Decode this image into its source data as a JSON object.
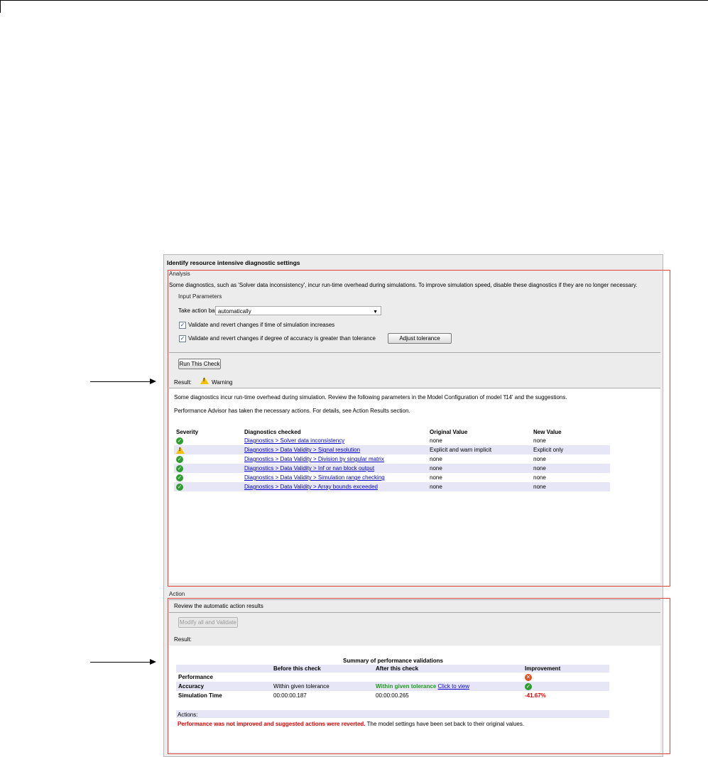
{
  "panel": {
    "title": "Identify resource intensive diagnostic settings",
    "analysis_label": "Analysis",
    "analysis_text": "Some diagnostics, such as 'Solver data inconsistency', incur run-time overhead during simulations. To improve simulation speed, disable these diagnostics if they are no longer necessary.",
    "input_parameters_label": "Input Parameters",
    "take_action_label": "Take action based on advice",
    "take_action_value": "automatically",
    "checkbox_time_label": "Validate and revert changes if time of simulation increases",
    "checkbox_accuracy_label": "Validate and revert changes if degree of accuracy is greater than tolerance",
    "adjust_tolerance_label": "Adjust tolerance",
    "run_check_label": "Run This Check",
    "result_label": "Result:",
    "result_status": "Warning",
    "result_text_1": "Some diagnostics incur run-time overhead during simulation. Review the following parameters in the Model Configuration of model 'f14' and the suggestions.",
    "result_text_2": "Performance Advisor has taken the necessary actions. For details, see Action Results section."
  },
  "diagnostics_table": {
    "headers": [
      "Severity",
      "Diagnostics checked",
      "Original Value",
      "New Value"
    ],
    "rows": [
      {
        "severity": "ok",
        "diagnostic": "Diagnostics > Solver data inconsistency",
        "original": "none",
        "new": "none"
      },
      {
        "severity": "warning",
        "diagnostic": "Diagnostics > Data Validity > Signal resolution",
        "original": "Explicit and warn implicit",
        "new": "Explicit only"
      },
      {
        "severity": "ok",
        "diagnostic": "Diagnostics > Data Validity > Division by singular matrix",
        "original": "none",
        "new": "none"
      },
      {
        "severity": "ok",
        "diagnostic": "Diagnostics > Data Validity > Inf or nan block output",
        "original": "none",
        "new": "none"
      },
      {
        "severity": "ok",
        "diagnostic": "Diagnostics > Data Validity > Simulation range checking",
        "original": "none",
        "new": "none"
      },
      {
        "severity": "ok",
        "diagnostic": "Diagnostics > Data Validity > Array bounds exceeded",
        "original": "none",
        "new": "none"
      }
    ]
  },
  "action": {
    "label": "Action",
    "review_text": "Review the automatic action results",
    "modify_button_label": "Modify all and Validate",
    "result_label": "Result:"
  },
  "summary_table": {
    "title": "Summary of performance validations",
    "headers": [
      "",
      "Before this check",
      "After this check",
      "Improvement"
    ],
    "performance_label": "Performance",
    "accuracy_label": "Accuracy",
    "accuracy_before": "Within given tolerance",
    "accuracy_after": "Within given tolerance",
    "click_to_view": "Click to view",
    "simtime_label": "Simulation Time",
    "simtime_before": "00:00:00.187",
    "simtime_after": "00:00:00.265",
    "simtime_improvement": "-41.67%"
  },
  "actions_note": {
    "label": "Actions:",
    "bold_text": "Performance was not improved and suggested actions were reverted.",
    "rest_text": " The model settings have been set back to their original values."
  },
  "colors": {
    "annotation_box": "#e0453a",
    "ok": "#2e9e2e",
    "warning": "#f2c200",
    "error": "#e05022"
  }
}
